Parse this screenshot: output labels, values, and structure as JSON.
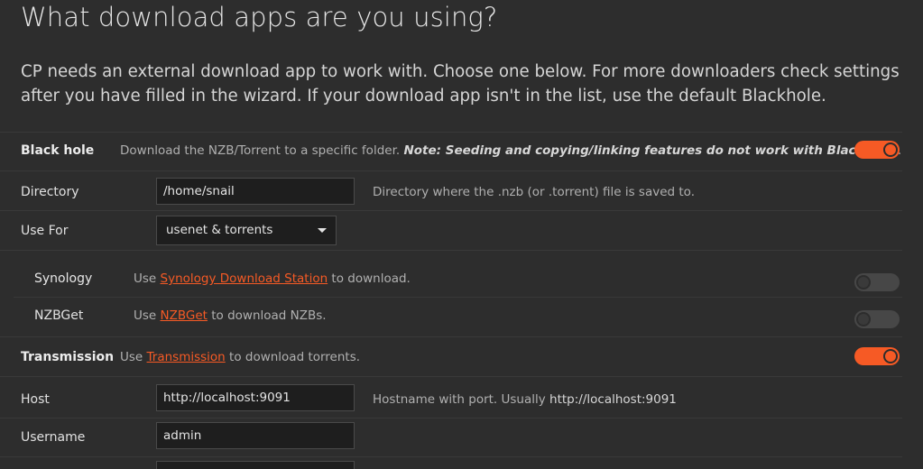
{
  "page": {
    "title": "What download apps are you using?",
    "intro": "CP needs an external download app to work with. Choose one below. For more downloaders check settings after you have filled in the wizard. If your download app isn't in the list, use the default Blackhole."
  },
  "blackhole": {
    "label": "Black hole",
    "desc_prefix": "Download the NZB/Torrent to a specific folder. ",
    "desc_note": "Note: Seeding and copying/linking features do not work with Black hole",
    "desc_suffix": ".",
    "enabled": true,
    "directory": {
      "label": "Directory",
      "value": "/home/snail",
      "hint": "Directory where the .nzb (or .torrent) file is saved to."
    },
    "use_for": {
      "label": "Use For",
      "value": "usenet & torrents"
    }
  },
  "synology": {
    "label": "Synology",
    "desc_prefix": "Use ",
    "link": "Synology Download Station",
    "desc_suffix": " to download.",
    "enabled": false
  },
  "nzbget": {
    "label": "NZBGet",
    "desc_prefix": "Use ",
    "link": "NZBGet",
    "desc_suffix": " to download NZBs.",
    "enabled": false
  },
  "transmission": {
    "label": "Transmission",
    "desc_prefix": "Use ",
    "link": "Transmission",
    "desc_suffix": " to download torrents.",
    "enabled": true,
    "host": {
      "label": "Host",
      "value": "http://localhost:9091",
      "hint_prefix": "Hostname with port. Usually ",
      "hint_value": "http://localhost:9091"
    },
    "username": {
      "label": "Username",
      "value": "admin"
    }
  },
  "colors": {
    "accent": "#f65a25",
    "background": "#2d2d2d",
    "input_bg": "#1e1e1e"
  },
  "icons": {
    "select_caret": "caret-down-icon"
  }
}
